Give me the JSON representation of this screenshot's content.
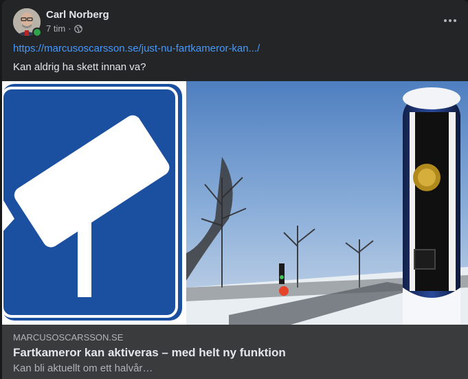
{
  "post": {
    "author": "Carl Norberg",
    "time": "7 tim",
    "separator": "·",
    "privacy_icon": "globe-icon",
    "link_url": "https://marcusoscarsson.se/just-nu-fartkameror-kan.../",
    "text": "Kan aldrig ha skett innan va?"
  },
  "link_preview": {
    "domain": "MARCUSOSCARSSON.SE",
    "title": "Fartkameror kan aktiveras – med helt ny funktion",
    "description": "Kan bli aktuellt om ett halvår…"
  },
  "colors": {
    "card_bg": "#242526",
    "preview_bg": "#3a3b3c",
    "link": "#4599ff",
    "sign_blue": "#1b4fa0",
    "online": "#31a24c"
  }
}
